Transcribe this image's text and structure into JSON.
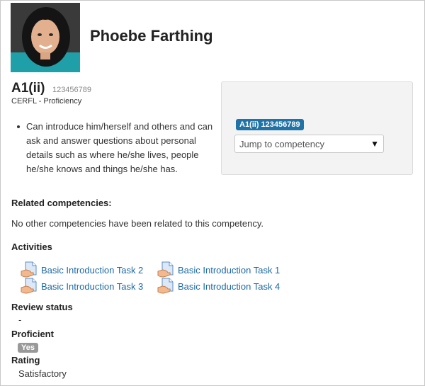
{
  "user": {
    "name": "Phoebe Farthing"
  },
  "competency": {
    "shortname": "A1(ii)",
    "idnumber": "123456789",
    "framework": "CERFL - Proficiency",
    "description": "Can introduce him/herself and others and can ask and answer questions about personal details such as where he/she lives, people he/she knows and things he/she has."
  },
  "navigation": {
    "badge": "A1(ii) 123456789",
    "jump_placeholder": "Jump to competency"
  },
  "related": {
    "heading": "Related competencies:",
    "empty_text": "No other competencies have been related to this competency."
  },
  "activities": {
    "heading": "Activities",
    "items": [
      "Basic Introduction Task 2",
      "Basic Introduction Task 1",
      "Basic Introduction Task 3",
      "Basic Introduction Task 4"
    ]
  },
  "review": {
    "heading": "Review status",
    "value": "-"
  },
  "proficient": {
    "heading": "Proficient",
    "value": "Yes"
  },
  "rating": {
    "heading": "Rating",
    "value": "Satisfactory"
  },
  "colors": {
    "link": "#1c6aa5",
    "badge_blue": "#1f73a6",
    "badge_grey": "#999999"
  }
}
